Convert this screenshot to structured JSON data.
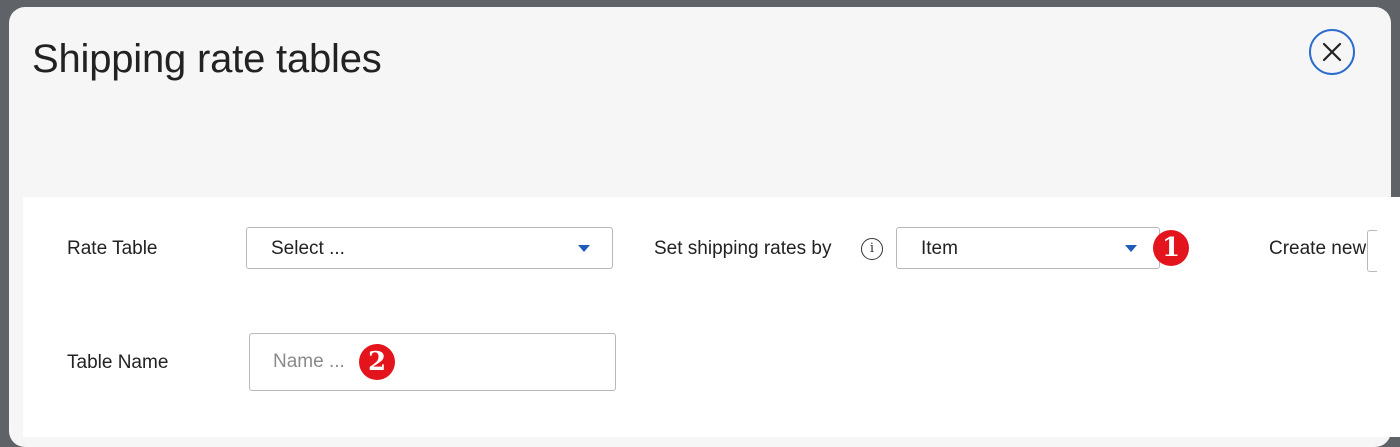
{
  "dialog": {
    "title": "Shipping rate tables",
    "close_icon": "close-icon"
  },
  "form": {
    "rate_table": {
      "label": "Rate Table",
      "selected": "Select ..."
    },
    "set_rates_by": {
      "label": "Set shipping rates by",
      "info_icon": "info-icon",
      "info_glyph": "i",
      "selected": "Item",
      "badge": "1"
    },
    "create_new": {
      "label": "Create new"
    },
    "table_name": {
      "label": "Table Name",
      "placeholder": "Name ...",
      "value": "",
      "badge": "2"
    }
  },
  "colors": {
    "accent": "#2c6dcc",
    "caret": "#1f5bb8",
    "badge": "#e3141b",
    "backdrop": "#5f6368",
    "modal_bg": "#f6f6f6"
  }
}
